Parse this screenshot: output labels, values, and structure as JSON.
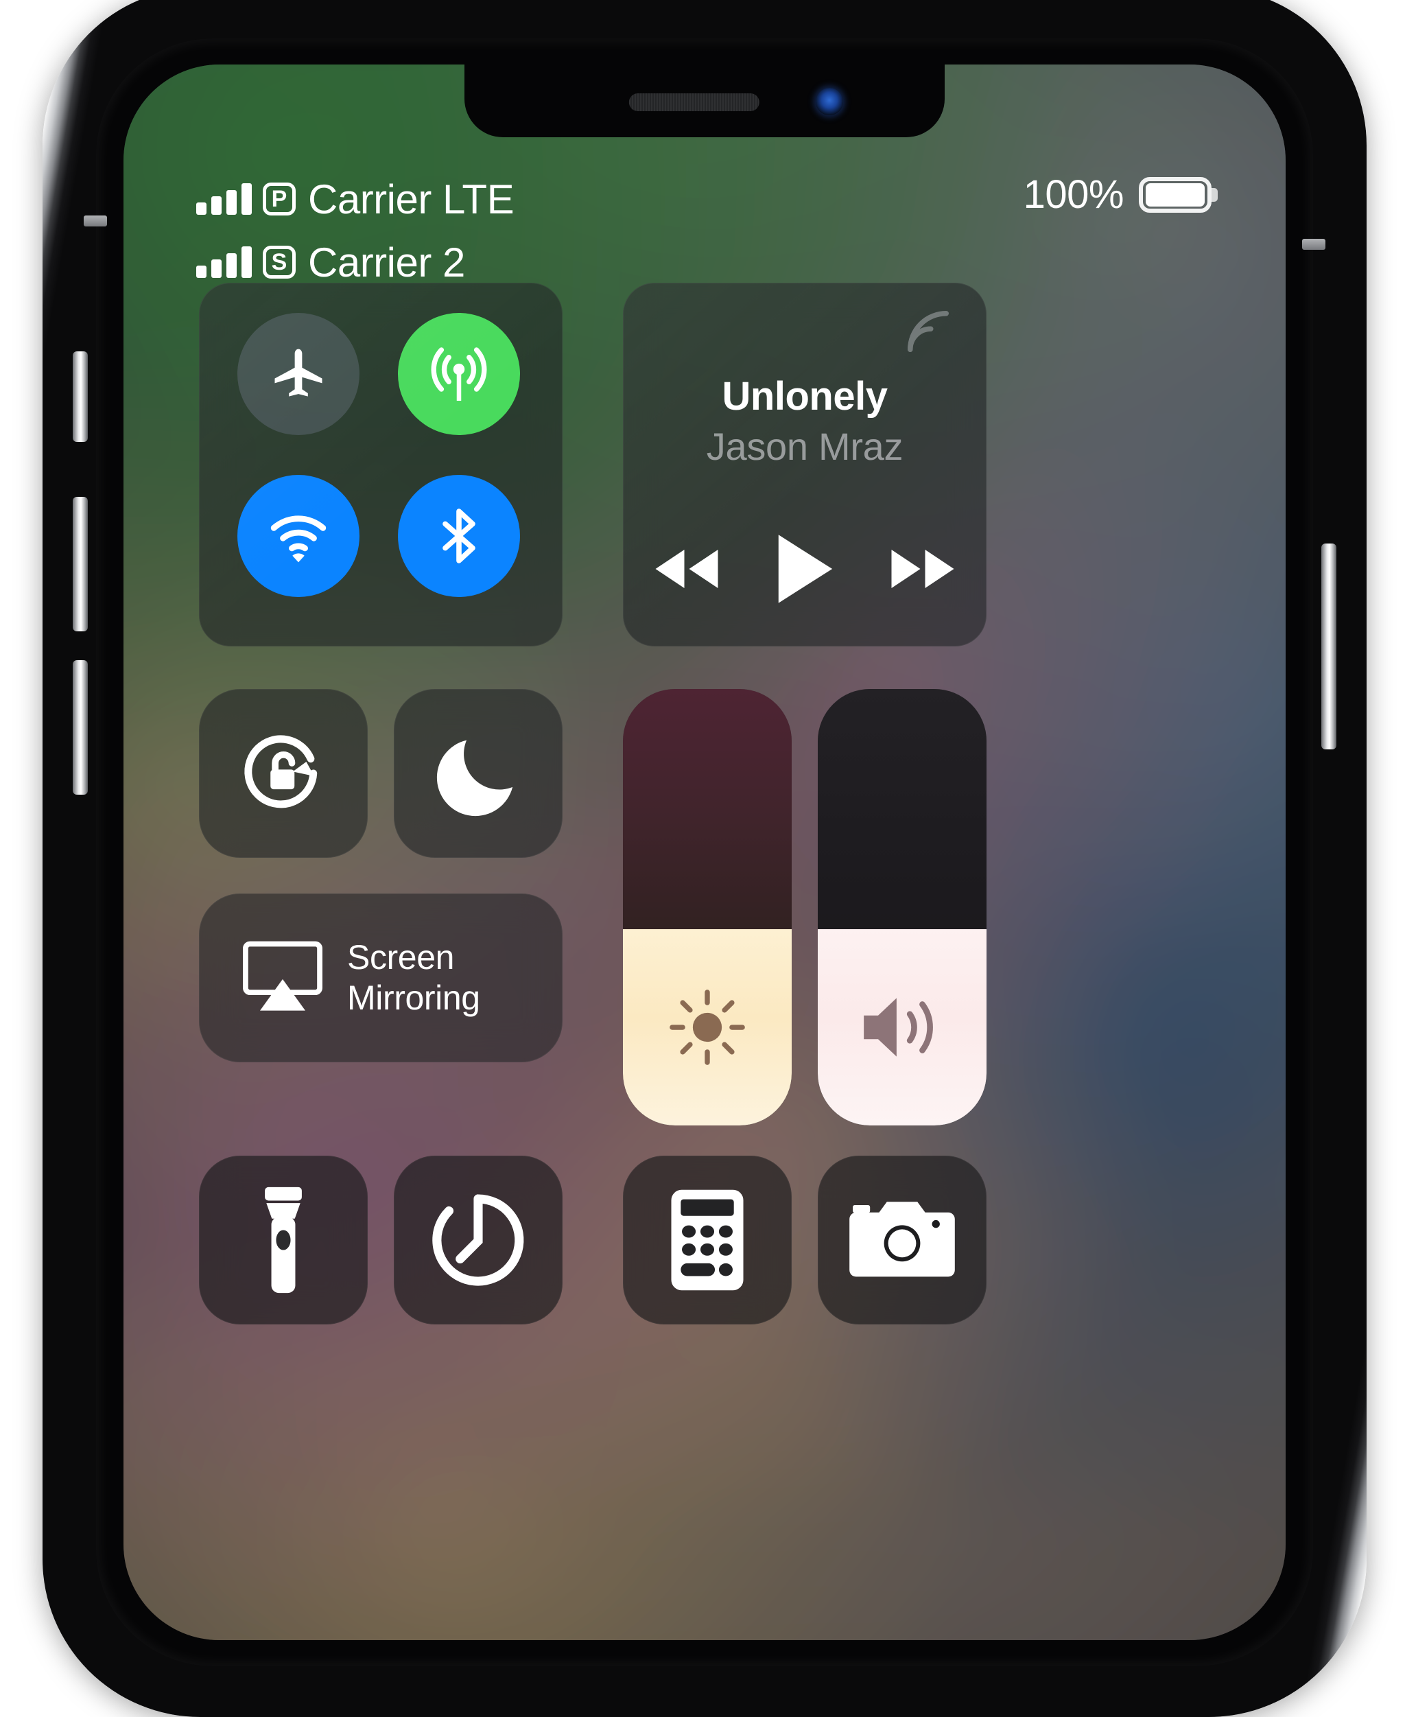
{
  "device": {
    "notch": {
      "earpiece": "earpiece-speaker",
      "front_camera": "front-camera"
    },
    "buttons": [
      "silent-switch",
      "volume-up",
      "volume-down",
      "side-button"
    ]
  },
  "status_bar": {
    "lines": [
      {
        "signal_bars": 4,
        "sim_badge": "P",
        "carrier": "Carrier LTE"
      },
      {
        "signal_bars": 4,
        "sim_badge": "S",
        "carrier": "Carrier 2"
      }
    ],
    "battery_percent": "100%",
    "battery_level": 100
  },
  "connectivity": {
    "toggles": [
      {
        "name": "airplane-mode",
        "icon": "airplane-icon",
        "state": "off",
        "color": "#5c6870"
      },
      {
        "name": "cellular-data",
        "icon": "cellular-antenna-icon",
        "state": "on",
        "color": "#49da5d"
      },
      {
        "name": "wifi",
        "icon": "wifi-icon",
        "state": "on",
        "color": "#0b84ff"
      },
      {
        "name": "bluetooth",
        "icon": "bluetooth-icon",
        "state": "on",
        "color": "#0b84ff"
      }
    ]
  },
  "now_playing": {
    "title": "Unlonely",
    "artist": "Jason Mraz",
    "airplay_icon": "airplay-audio-icon",
    "controls": [
      {
        "name": "rewind-button",
        "icon": "rewind-icon"
      },
      {
        "name": "play-button",
        "icon": "play-icon"
      },
      {
        "name": "fast-forward-button",
        "icon": "fast-forward-icon"
      }
    ]
  },
  "toggles": {
    "rotation_lock": {
      "icon": "rotation-lock-icon",
      "state": "off"
    },
    "do_not_disturb": {
      "icon": "moon-icon",
      "state": "off"
    }
  },
  "screen_mirroring": {
    "label_line1": "Screen",
    "label_line2": "Mirroring",
    "icon": "airplay-screen-icon"
  },
  "sliders": [
    {
      "name": "brightness-slider",
      "icon": "sun-icon",
      "level_percent": 45,
      "fill_color": "#fbe9c2"
    },
    {
      "name": "volume-slider",
      "icon": "speaker-icon",
      "level_percent": 45,
      "fill_color": "#fbeaea"
    }
  ],
  "shortcuts": [
    {
      "name": "flashlight-button",
      "icon": "flashlight-icon"
    },
    {
      "name": "timer-button",
      "icon": "timer-icon"
    },
    {
      "name": "calculator-button",
      "icon": "calculator-icon"
    },
    {
      "name": "camera-button",
      "icon": "camera-icon"
    }
  ],
  "colors": {
    "accent_blue": "#0b84ff",
    "accent_green": "#49da5d",
    "module_bg": "rgba(34,36,38,0.60)",
    "text_primary": "#ffffff",
    "text_secondary": "rgba(235,235,240,0.55)"
  }
}
